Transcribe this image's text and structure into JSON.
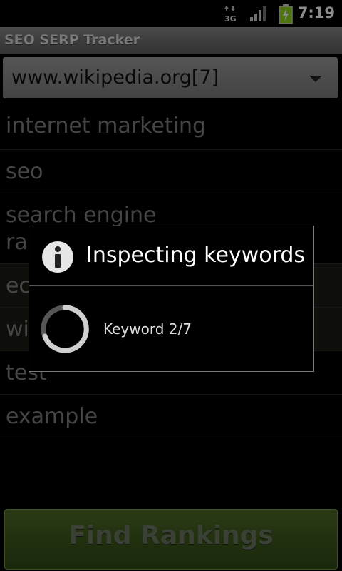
{
  "status_bar": {
    "network": "3G",
    "time": "7:19"
  },
  "app": {
    "title": "SEO SERP Tracker"
  },
  "site_selector": {
    "value": "www.wikipedia.org[7]"
  },
  "keywords": [
    {
      "label": "internet marketing"
    },
    {
      "label": "seo"
    },
    {
      "label": "search engine ranking"
    },
    {
      "label": "economy"
    },
    {
      "label": "wikipedia"
    },
    {
      "label": "test"
    },
    {
      "label": "example"
    }
  ],
  "dialog": {
    "title": "Inspecting keywords",
    "message": "Keyword 2/7",
    "icon": "info-icon"
  },
  "actions": {
    "find_label": "Find Rankings"
  },
  "colors": {
    "button_green": "#3d5a1d",
    "battery_green": "#8fd41c"
  }
}
